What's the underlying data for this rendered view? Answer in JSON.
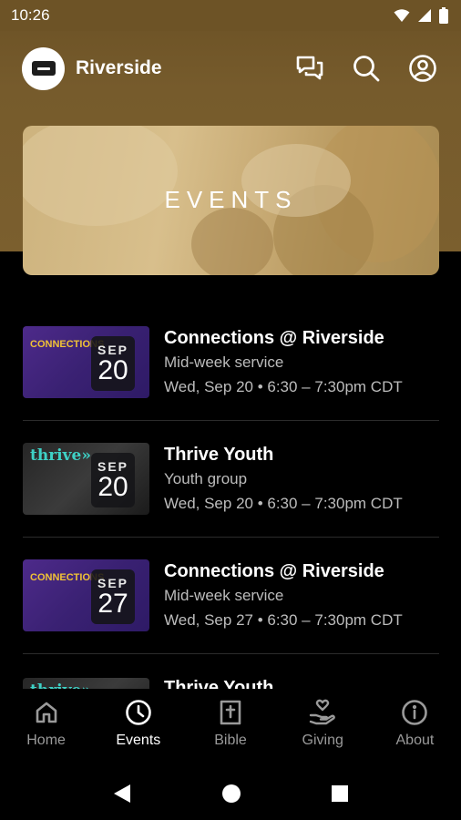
{
  "status_bar": {
    "time": "10:26"
  },
  "header": {
    "title": "Riverside"
  },
  "banner": {
    "title": "EVENTS"
  },
  "events": [
    {
      "title": "Connections @ Riverside",
      "subtitle": "Mid-week service",
      "datetime": "Wed, Sep 20 • 6:30 – 7:30pm CDT",
      "badge_month": "SEP",
      "badge_day": "20",
      "thumb": "connections"
    },
    {
      "title": "Thrive Youth",
      "subtitle": "Youth group",
      "datetime": "Wed, Sep 20 • 6:30 – 7:30pm CDT",
      "badge_month": "SEP",
      "badge_day": "20",
      "thumb": "thrive"
    },
    {
      "title": "Connections @ Riverside",
      "subtitle": "Mid-week service",
      "datetime": "Wed, Sep 27 • 6:30 – 7:30pm CDT",
      "badge_month": "SEP",
      "badge_day": "27",
      "thumb": "connections"
    },
    {
      "title": "Thrive Youth",
      "thumb": "thrive"
    }
  ],
  "thumb_text": {
    "connections": "CONNECTIONS",
    "thrive": "thrive»"
  },
  "bottom_nav": [
    {
      "label": "Home",
      "icon": "home-icon",
      "active": false
    },
    {
      "label": "Events",
      "icon": "clock-icon",
      "active": true
    },
    {
      "label": "Bible",
      "icon": "bible-icon",
      "active": false
    },
    {
      "label": "Giving",
      "icon": "giving-icon",
      "active": false
    },
    {
      "label": "About",
      "icon": "info-icon",
      "active": false
    }
  ],
  "colors": {
    "header_brown": "#765b2c",
    "banner_tan": "#cdb37e",
    "background": "#000000",
    "nav_inactive": "#9a9a9a"
  }
}
